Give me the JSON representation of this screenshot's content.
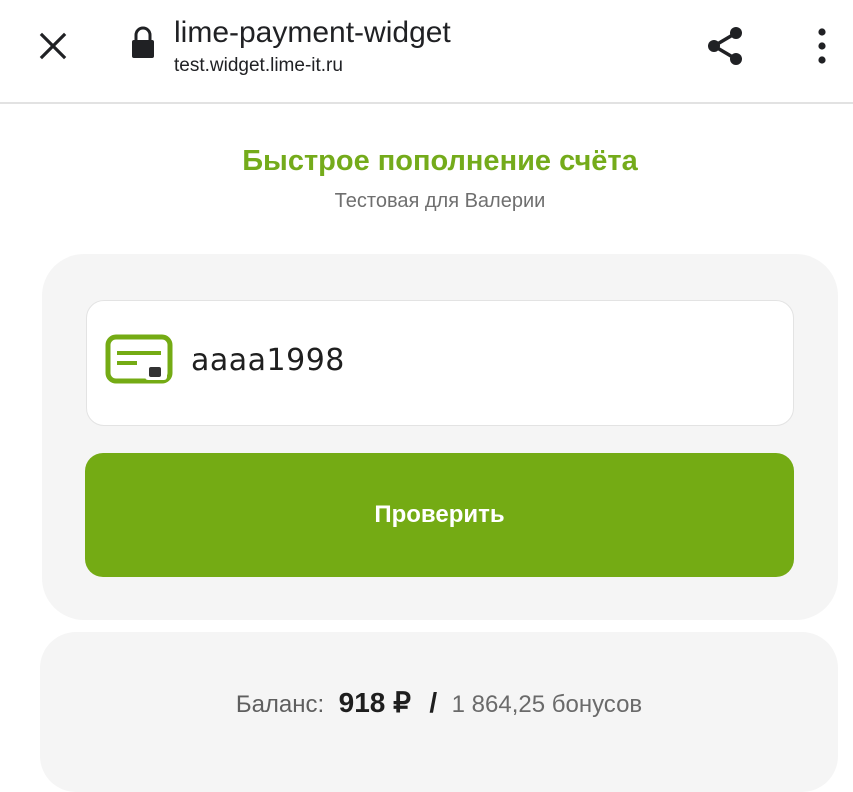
{
  "browser": {
    "title": "lime-payment-widget",
    "url": "test.widget.lime-it.ru",
    "icons": [
      "close-icon",
      "lock-icon",
      "share-icon",
      "more-vert-icon"
    ]
  },
  "header": {
    "title": "Быстрое пополнение счёта",
    "subtitle": "Тестовая для Валерии"
  },
  "form": {
    "account_value": "aaaa1998",
    "account_icon": "card-icon",
    "submit_label": "Проверить"
  },
  "balance": {
    "label": "Баланс:",
    "amount": "918 ₽",
    "separator": "/",
    "bonus": "1 864,25 бонусов"
  },
  "colors": {
    "accent": "#74ab14",
    "heading": "#74ab1b",
    "card_bg": "#f5f5f5"
  }
}
